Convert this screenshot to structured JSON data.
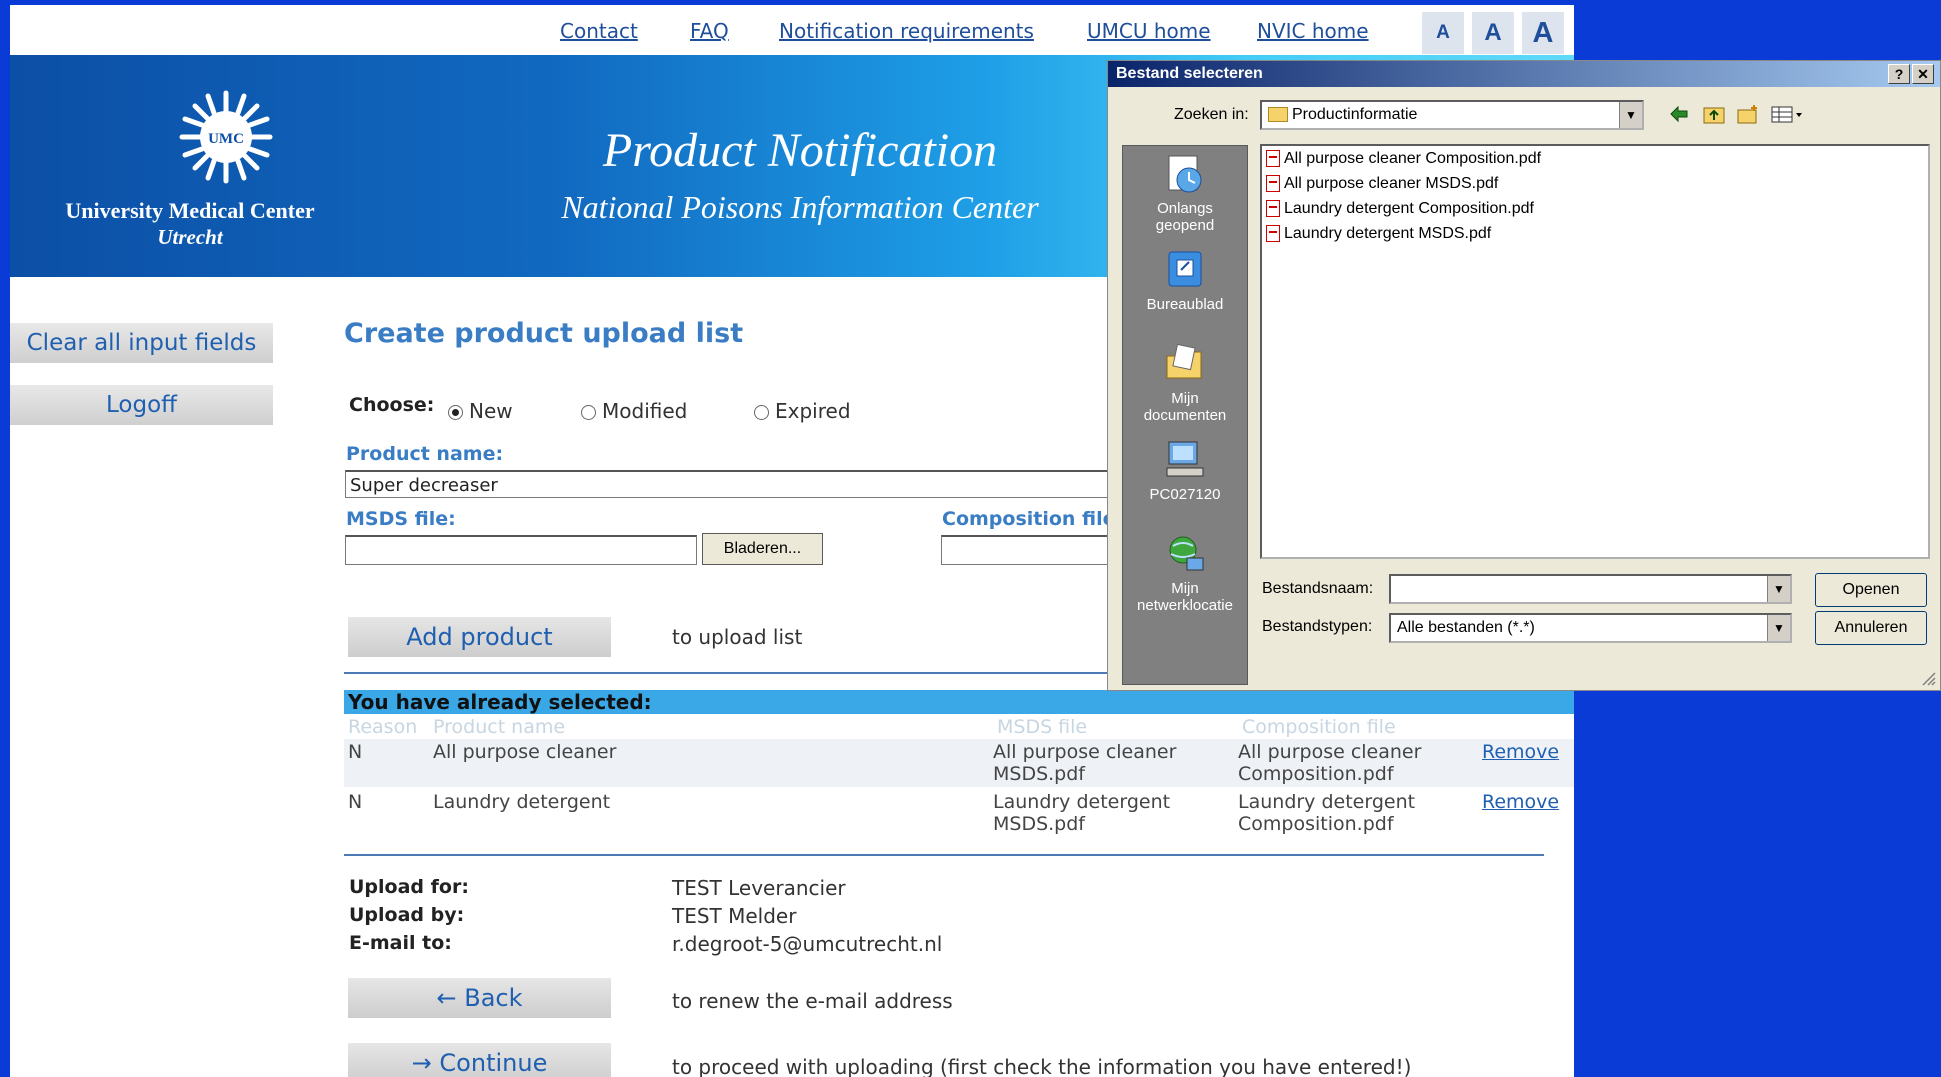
{
  "top_links": [
    "Contact",
    "FAQ",
    "Notification requirements",
    "UMCU home",
    "NVIC home"
  ],
  "font_size_buttons": [
    "A",
    "A",
    "A"
  ],
  "logo": {
    "badge": "UMC",
    "line1": "University Medical Center",
    "line2": "Utrecht"
  },
  "banner": {
    "title": "Product Notification",
    "subtitle": "National Poisons Information Center"
  },
  "sidebar": {
    "clear_label": "Clear all input fields",
    "logoff_label": "Logoff"
  },
  "form": {
    "heading": "Create product upload list",
    "choose_label": "Choose:",
    "options": [
      {
        "label": "New",
        "selected": true
      },
      {
        "label": "Modified",
        "selected": false
      },
      {
        "label": "Expired",
        "selected": false
      }
    ],
    "product_name_label": "Product name:",
    "product_name_value": "Super decreaser",
    "msds_label": "MSDS file:",
    "msds_value": "",
    "browse_label": "Bladeren...",
    "composition_label": "Composition file",
    "composition_value": "",
    "add_button": "Add product",
    "add_hint": "to upload list"
  },
  "selected": {
    "title": "You have already selected:",
    "columns": [
      "Reason",
      "Product name",
      "MSDS file",
      "Composition file"
    ],
    "rows": [
      {
        "reason": "N",
        "product": "All purpose cleaner",
        "msds_1": "All purpose cleaner",
        "msds_2": "MSDS.pdf",
        "comp_1": "All purpose cleaner",
        "comp_2": "Composition.pdf",
        "action": "Remove"
      },
      {
        "reason": "N",
        "product": "Laundry detergent",
        "msds_1": "Laundry detergent",
        "msds_2": "MSDS.pdf",
        "comp_1": "Laundry detergent",
        "comp_2": "Composition.pdf",
        "action": "Remove"
      }
    ]
  },
  "upload_info": {
    "for_label": "Upload for:",
    "for_value": "TEST Leverancier",
    "by_label": "Upload by:",
    "by_value": "TEST Melder",
    "email_label": "E-mail to:",
    "email_value": "r.degroot-5@umcutrecht.nl"
  },
  "nav": {
    "back_label": "← Back",
    "back_hint": "to renew the e-mail address",
    "continue_label": "→ Continue",
    "continue_hint": "to proceed with uploading (first check the information you have entered!)"
  },
  "dialog": {
    "title": "Bestand selecteren",
    "help_btn": "?",
    "close_btn": "✕",
    "look_in_label": "Zoeken in:",
    "look_in_value": "Productinformatie",
    "places": [
      {
        "label1": "Onlangs",
        "label2": "geopend",
        "icon": "recent-icon"
      },
      {
        "label1": "Bureaublad",
        "label2": "",
        "icon": "desktop-icon"
      },
      {
        "label1": "Mijn",
        "label2": "documenten",
        "icon": "my-documents-icon"
      },
      {
        "label1": "PC027120",
        "label2": "",
        "icon": "computer-icon"
      },
      {
        "label1": "Mijn",
        "label2": "netwerklocatie",
        "icon": "network-icon"
      }
    ],
    "files": [
      "All purpose cleaner Composition.pdf",
      "All purpose cleaner MSDS.pdf",
      "Laundry detergent Composition.pdf",
      "Laundry detergent MSDS.pdf"
    ],
    "filename_label": "Bestandsnaam:",
    "filename_value": "",
    "filetype_label": "Bestandstypen:",
    "filetype_value": "Alle bestanden (*.*)",
    "open_btn": "Openen",
    "cancel_btn": "Annuleren"
  },
  "colors": {
    "background": "#0b3bd6",
    "heading_blue": "#3a7dc4",
    "selected_bar": "#3aa7e6",
    "dialog_title": "#0a246a"
  }
}
